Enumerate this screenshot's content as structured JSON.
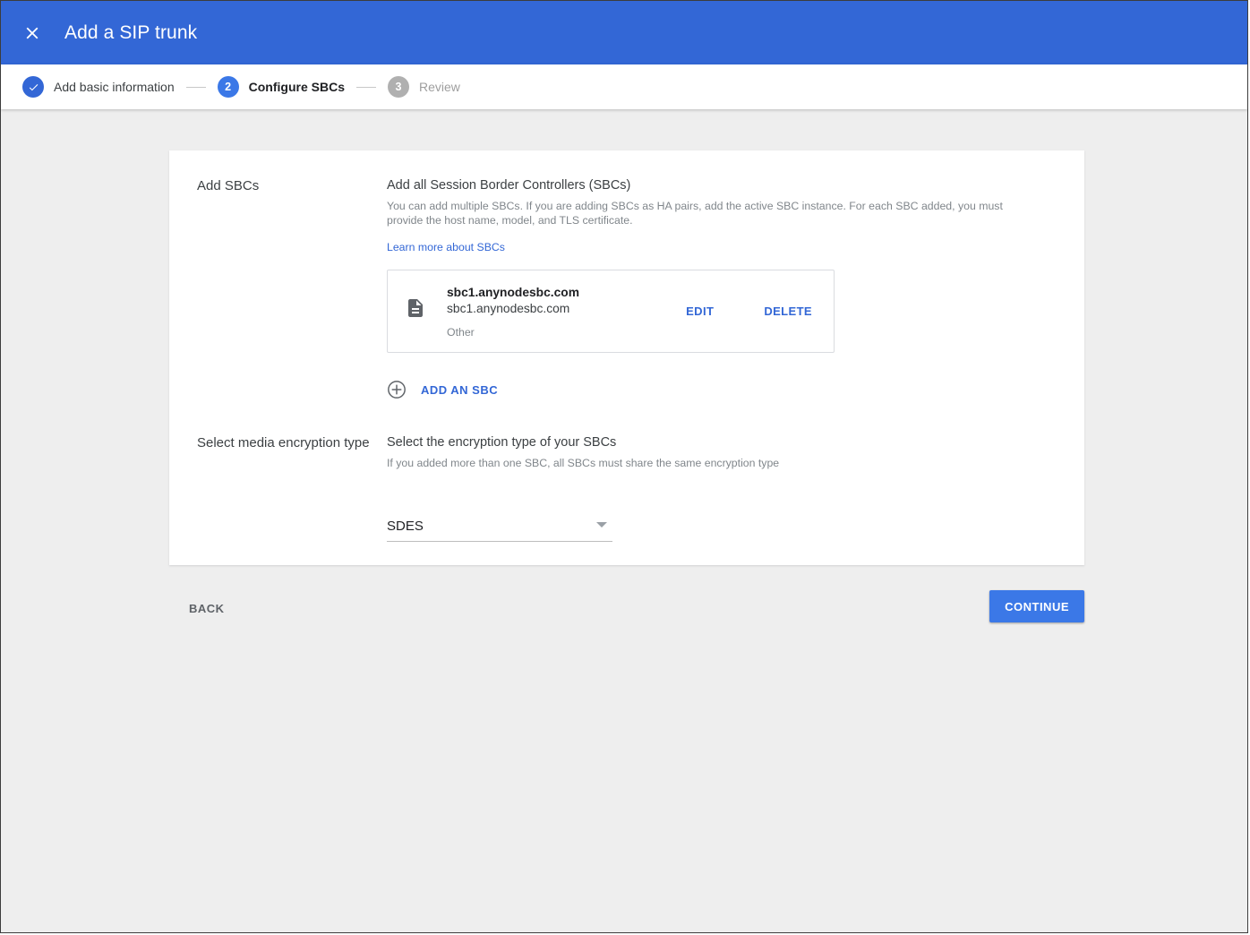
{
  "header": {
    "close_icon": "close-icon",
    "title": "Add a SIP trunk",
    "background_color": "#3367d6"
  },
  "stepper": {
    "steps": [
      {
        "marker": "✓",
        "label": "Add basic information",
        "state": "done"
      },
      {
        "marker": "2",
        "label": "Configure SBCs",
        "state": "active"
      },
      {
        "marker": "3",
        "label": "Review",
        "state": "todo"
      }
    ]
  },
  "sections": {
    "sbcs": {
      "title": "Add SBCs",
      "heading": "Add all Session Border Controllers (SBCs)",
      "description": "You can add multiple SBCs. If you are adding SBCs as HA pairs, add the active SBC instance. For each SBC added, you must provide the host name, model, and TLS certificate.",
      "learn_more": "Learn more about SBCs",
      "item": {
        "icon": "description-icon",
        "name": "sbc1.anynodesbc.com",
        "host": "sbc1.anynodesbc.com",
        "model": "Other",
        "edit_label": "EDIT",
        "delete_label": "DELETE"
      },
      "add_button": {
        "icon": "plus-circle-icon",
        "label": "ADD AN SBC"
      }
    },
    "encryption": {
      "title": "Select media encryption type",
      "heading": "Select the encryption type of your SBCs",
      "description": "If you added more than one SBC, all SBCs must share the same encryption type",
      "select": {
        "value": "SDES",
        "arrow_icon": "chevron-down-icon"
      }
    }
  },
  "footer": {
    "back_label": "BACK",
    "continue_label": "CONTINUE",
    "continue_color": "#3b78e7"
  }
}
